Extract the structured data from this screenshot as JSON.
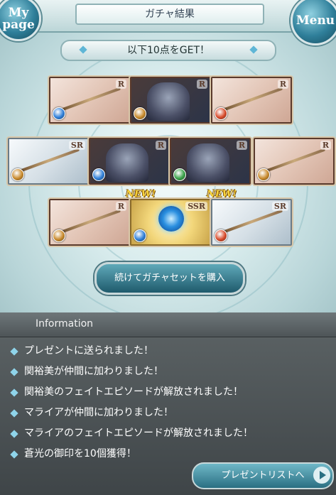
{
  "header": {
    "title": "ガチャ結果",
    "mypage_label_1": "My",
    "mypage_label_2": "page",
    "menu_label": "Menu"
  },
  "banner": {
    "text": "以下10点をGET！"
  },
  "rows": [
    [
      {
        "rarity": "R",
        "element": "water",
        "element_color": "#2f7fd8",
        "kind": "weapon"
      },
      {
        "rarity": "R",
        "element": "earth",
        "element_color": "#c98a2c",
        "kind": "beast"
      },
      {
        "rarity": "R",
        "element": "fire",
        "element_color": "#d84a2a",
        "kind": "weapon"
      }
    ],
    [
      {
        "rarity": "SR",
        "element": "earth",
        "element_color": "#c98a2c",
        "kind": "weapon"
      },
      {
        "rarity": "R",
        "element": "water",
        "element_color": "#2f7fd8",
        "kind": "beast"
      },
      {
        "rarity": "R",
        "element": "wind",
        "element_color": "#3aa24a",
        "kind": "character"
      },
      {
        "rarity": "R",
        "element": "earth",
        "element_color": "#c98a2c",
        "kind": "weapon"
      }
    ],
    [
      {
        "rarity": "R",
        "element": "earth",
        "element_color": "#c98a2c",
        "kind": "weapon"
      },
      {
        "rarity": "SSR",
        "element": "water",
        "element_color": "#2f7fd8",
        "kind": "summon",
        "is_new": true
      },
      {
        "rarity": "SR",
        "element": "fire",
        "element_color": "#d84a2a",
        "kind": "weapon",
        "is_new": true
      }
    ]
  ],
  "new_label": "NEW!",
  "buy_button": "続けてガチャセットを購入",
  "info": {
    "title": "Information",
    "items": [
      "プレゼントに送られました！",
      "関裕美が仲間に加わりました！",
      "関裕美のフェイトエピソードが解放されました！",
      "マライアが仲間に加わりました！",
      "マライアのフェイトエピソードが解放されました！",
      "蒼光の御印を10個獲得！"
    ]
  },
  "present_button": "プレゼントリストへ"
}
